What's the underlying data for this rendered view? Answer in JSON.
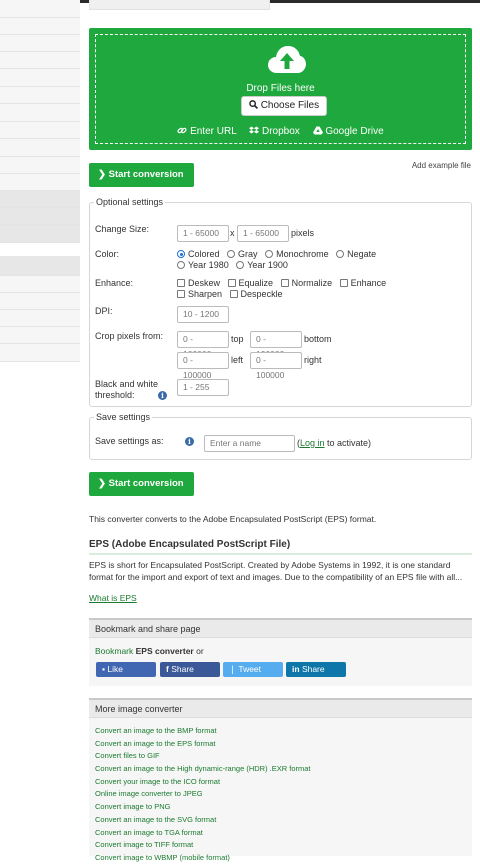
{
  "dropzone": {
    "drop_text": "Drop Files here",
    "choose_label": "Choose Files",
    "sources": [
      {
        "icon": "link-icon",
        "label": "Enter URL"
      },
      {
        "icon": "dropbox-icon",
        "label": "Dropbox"
      },
      {
        "icon": "google-drive-icon",
        "label": "Google Drive"
      }
    ]
  },
  "start_conversion": "Start conversion",
  "add_example": "Add example file",
  "optional": {
    "legend": "Optional settings",
    "change_size": {
      "label": "Change Size:",
      "width_placeholder": "1 - 65000",
      "sep": "x",
      "height_placeholder": "1 - 65000",
      "unit": "pixels"
    },
    "color": {
      "label": "Color:",
      "options": [
        "Colored",
        "Gray",
        "Monochrome",
        "Negate",
        "Year 1980",
        "Year 1900"
      ],
      "selected": "Colored"
    },
    "enhance": {
      "label": "Enhance:",
      "options": [
        "Deskew",
        "Equalize",
        "Normalize",
        "Enhance",
        "Sharpen",
        "Despeckle"
      ]
    },
    "dpi": {
      "label": "DPI:",
      "placeholder": "10 - 1200"
    },
    "crop": {
      "label": "Crop pixels from:",
      "placeholder": "0 - 100000",
      "top": "top",
      "bottom": "bottom",
      "left": "left",
      "right": "right"
    },
    "threshold": {
      "label_line1": "Black and white",
      "label_line2": "threshold:",
      "placeholder": "1 - 255"
    }
  },
  "save": {
    "legend": "Save settings",
    "label": "Save settings as:",
    "placeholder": "Enter a name",
    "paren_open": "(",
    "login": "Log in",
    "activate": " to activate)"
  },
  "intro": "This converter converts to the Adobe Encapsulated PostScript (EPS) format.",
  "eps": {
    "heading": "EPS (Adobe Encapsulated PostScript File)",
    "body": "EPS is short for Encapsulated PostScript. Created by Adobe Systems in 1992, it is one standard format for the import and export of text and images. Due to the compatibility of an EPS file with all...",
    "link": "What is EPS"
  },
  "bookmark": {
    "heading": "Bookmark and share page",
    "prefix": "Bookmark ",
    "bold": "EPS converter",
    "suffix": " or",
    "buttons": [
      {
        "icon": "facebook-like-icon",
        "label": "Like",
        "color": "#4267b2"
      },
      {
        "icon": "facebook-icon",
        "label": "Share",
        "color": "#3b5998"
      },
      {
        "icon": "twitter-icon",
        "label": "Tweet",
        "color": "#55acee"
      },
      {
        "icon": "linkedin-icon",
        "label": "Share",
        "color": "#0e76a8"
      }
    ]
  },
  "more": {
    "heading": "More image converter",
    "items": [
      "Convert an image to the BMP format",
      "Convert an image to the EPS format",
      "Convert files to GIF",
      "Convert an image to the High dynamic-range (HDR) .EXR format",
      "Convert your image to the ICO format",
      "Online image converter to JPEG",
      "Convert image to PNG",
      "Convert an image to the SVG format",
      "Convert an image to TGA format",
      "Convert image to TIFF format",
      "Convert image to WBMP (mobile format)"
    ]
  },
  "colors": {
    "accent": "#1fa83d",
    "link": "#1b7a2f",
    "info": "#3a6aa8"
  }
}
